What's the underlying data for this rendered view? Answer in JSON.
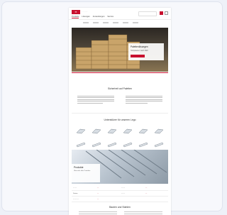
{
  "header": {
    "logo": "▪▪",
    "brand_line": "· · · · ·",
    "nav": [
      "Produkte",
      "Lösungen",
      "Anwendungen",
      "Service"
    ]
  },
  "hero": {
    "title": "Palettenlösungen",
    "subtitle": "Holzpaletten nach Maß"
  },
  "section1": {
    "title": "Sicherheit auf Paletten"
  },
  "section2": {
    "title": "Unterstützer für unseren Lego"
  },
  "products": [
    "p1",
    "p2",
    "p3",
    "p4",
    "p5",
    "p6",
    "p7",
    "p8",
    "p9",
    "p10",
    "p11",
    "p12"
  ],
  "banner": {
    "title": "Produkte",
    "subtitle": "Übersicht aller Produkte"
  },
  "table": {
    "rows": [
      [
        "— —",
        "—",
        "— —",
        "—"
      ],
      [
        "Datum",
        "—",
        "— —",
        "—"
      ],
      [
        "— — —",
        "—",
        "",
        ""
      ]
    ]
  },
  "section3": {
    "title": "Bauten und Stahlen"
  },
  "colors": {
    "accent": "#c8102e"
  }
}
